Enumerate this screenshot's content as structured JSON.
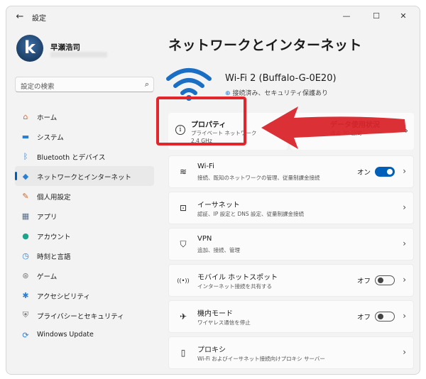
{
  "window": {
    "app_title": "設定",
    "back_icon": "back-arrow-icon",
    "controls": {
      "minimize": "—",
      "maximize": "☐",
      "close": "✕"
    }
  },
  "profile": {
    "name": "早瀬浩司"
  },
  "search": {
    "placeholder": "設定の検索",
    "icon": "🔍"
  },
  "sidebar": {
    "items": [
      {
        "label": "ホーム",
        "icon": "home-icon",
        "glyph": "⌂",
        "color": "#d86b2b",
        "selected": false
      },
      {
        "label": "システム",
        "icon": "system-icon",
        "glyph": "▬",
        "color": "#2a7fd4",
        "selected": false
      },
      {
        "label": "Bluetooth とデバイス",
        "icon": "bluetooth-icon",
        "glyph": "ᛒ",
        "color": "#2a7fd4",
        "selected": false
      },
      {
        "label": "ネットワークとインターネット",
        "icon": "network-icon",
        "glyph": "◆",
        "color": "#2a7fd4",
        "selected": true
      },
      {
        "label": "個人用設定",
        "icon": "brush-icon",
        "glyph": "✎",
        "color": "#c96a2c",
        "selected": false
      },
      {
        "label": "アプリ",
        "icon": "apps-icon",
        "glyph": "▦",
        "color": "#5a6f8a",
        "selected": false
      },
      {
        "label": "アカウント",
        "icon": "account-icon",
        "glyph": "●",
        "color": "#1fa38a",
        "selected": false
      },
      {
        "label": "時刻と言語",
        "icon": "clock-globe-icon",
        "glyph": "◷",
        "color": "#2a7fd4",
        "selected": false
      },
      {
        "label": "ゲーム",
        "icon": "gamepad-icon",
        "glyph": "⊛",
        "color": "#7a7a7a",
        "selected": false
      },
      {
        "label": "アクセシビリティ",
        "icon": "accessibility-icon",
        "glyph": "✱",
        "color": "#2a7fd4",
        "selected": false
      },
      {
        "label": "プライバシーとセキュリティ",
        "icon": "shield-icon",
        "glyph": "⛨",
        "color": "#6b6b6b",
        "selected": false
      },
      {
        "label": "Windows Update",
        "icon": "update-icon",
        "glyph": "⟳",
        "color": "#2a7fd4",
        "selected": false
      }
    ]
  },
  "main": {
    "title": "ネットワークとインターネット",
    "connection": {
      "name": "Wi-Fi 2 (Buffalo-G-0E20)",
      "status": "接続済み、セキュリティ保護あり",
      "wifi_color": "#1a6fc4"
    },
    "properties": {
      "title": "プロパティ",
      "line1": "プライベート ネットワーク",
      "line2": "2.4 GHz"
    },
    "data_usage": {
      "title": "データ使用状況",
      "sub": "過去 30 日間"
    },
    "annotation_color": "#e3262c",
    "rows": [
      {
        "title": "Wi-Fi",
        "sub": "接続、既知のネットワークの管理、従量制課金接続",
        "icon": "wifi-icon",
        "glyph": "≋",
        "toggle": "on",
        "toggle_label": "オン"
      },
      {
        "title": "イーサネット",
        "sub": "認証、IP 設定と DNS 設定、従量制課金接続",
        "icon": "ethernet-icon",
        "glyph": "⊡",
        "toggle": null,
        "toggle_label": ""
      },
      {
        "title": "VPN",
        "sub": "追加、接続、管理",
        "icon": "vpn-shield-icon",
        "glyph": "⛉",
        "toggle": null,
        "toggle_label": ""
      },
      {
        "title": "モバイル ホットスポット",
        "sub": "インターネット接続を共有する",
        "icon": "hotspot-icon",
        "glyph": "((•))",
        "toggle": "off",
        "toggle_label": "オフ"
      },
      {
        "title": "機内モード",
        "sub": "ワイヤレス通信を停止",
        "icon": "airplane-icon",
        "glyph": "✈",
        "toggle": "off",
        "toggle_label": "オフ"
      },
      {
        "title": "プロキシ",
        "sub": "Wi-Fi およびイーサネット接続向けプロキシ サーバー",
        "icon": "proxy-icon",
        "glyph": "▯",
        "toggle": null,
        "toggle_label": ""
      }
    ]
  }
}
